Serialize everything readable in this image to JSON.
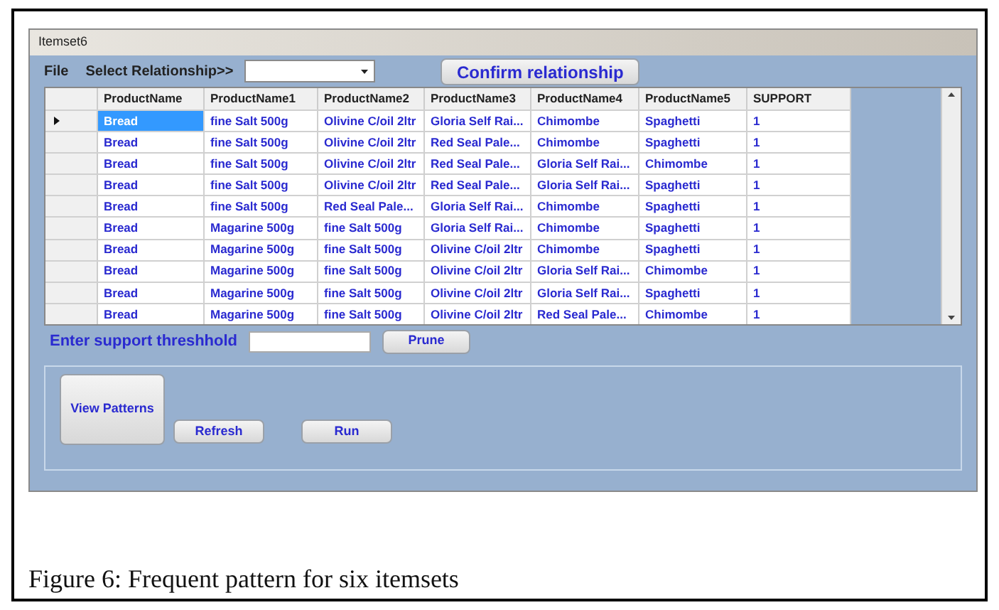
{
  "window": {
    "title": "Itemset6"
  },
  "menu": {
    "file": "File",
    "select_label": "Select Relationship>>",
    "confirm_button": "Confirm relationship"
  },
  "table": {
    "columns": [
      "ProductName",
      "ProductName1",
      "ProductName2",
      "ProductName3",
      "ProductName4",
      "ProductName5",
      "SUPPORT"
    ],
    "rows": [
      {
        "selected": true,
        "cells": [
          "Bread",
          "fine Salt 500g",
          "Olivine C/oil 2ltr",
          "Gloria Self Rai...",
          "Chimombe",
          "Spaghetti",
          "1"
        ]
      },
      {
        "selected": false,
        "cells": [
          "Bread",
          "fine Salt 500g",
          "Olivine C/oil 2ltr",
          "Red Seal Pale...",
          "Chimombe",
          "Spaghetti",
          "1"
        ]
      },
      {
        "selected": false,
        "cells": [
          "Bread",
          "fine Salt 500g",
          "Olivine C/oil 2ltr",
          "Red Seal Pale...",
          "Gloria Self Rai...",
          "Chimombe",
          "1"
        ]
      },
      {
        "selected": false,
        "cells": [
          "Bread",
          "fine Salt 500g",
          "Olivine C/oil 2ltr",
          "Red Seal Pale...",
          "Gloria Self Rai...",
          "Spaghetti",
          "1"
        ]
      },
      {
        "selected": false,
        "cells": [
          "Bread",
          "fine Salt 500g",
          "Red Seal Pale...",
          "Gloria Self Rai...",
          "Chimombe",
          "Spaghetti",
          "1"
        ]
      },
      {
        "selected": false,
        "cells": [
          "Bread",
          "Magarine 500g",
          "fine Salt 500g",
          "Gloria Self Rai...",
          "Chimombe",
          "Spaghetti",
          "1"
        ]
      },
      {
        "selected": false,
        "cells": [
          "Bread",
          "Magarine 500g",
          "fine Salt 500g",
          "Olivine C/oil 2ltr",
          "Chimombe",
          "Spaghetti",
          "1"
        ]
      },
      {
        "selected": false,
        "cells": [
          "Bread",
          "Magarine 500g",
          "fine Salt 500g",
          "Olivine C/oil 2ltr",
          "Gloria Self Rai...",
          "Chimombe",
          "1"
        ]
      },
      {
        "selected": false,
        "cells": [
          "Bread",
          "Magarine 500g",
          "fine Salt 500g",
          "Olivine C/oil 2ltr",
          "Gloria Self Rai...",
          "Spaghetti",
          "1"
        ]
      },
      {
        "selected": false,
        "cells": [
          "Bread",
          "Magarine 500g",
          "fine Salt 500g",
          "Olivine C/oil 2ltr",
          "Red Seal Pale...",
          "Chimombe",
          "1"
        ]
      }
    ]
  },
  "support": {
    "label": "Enter support threshhold",
    "prune_button": "Prune"
  },
  "actions": {
    "view_button": "View Patterns",
    "refresh_button": "Refresh",
    "run_button": "Run"
  },
  "caption": "Figure 6: Frequent pattern for six itemsets"
}
